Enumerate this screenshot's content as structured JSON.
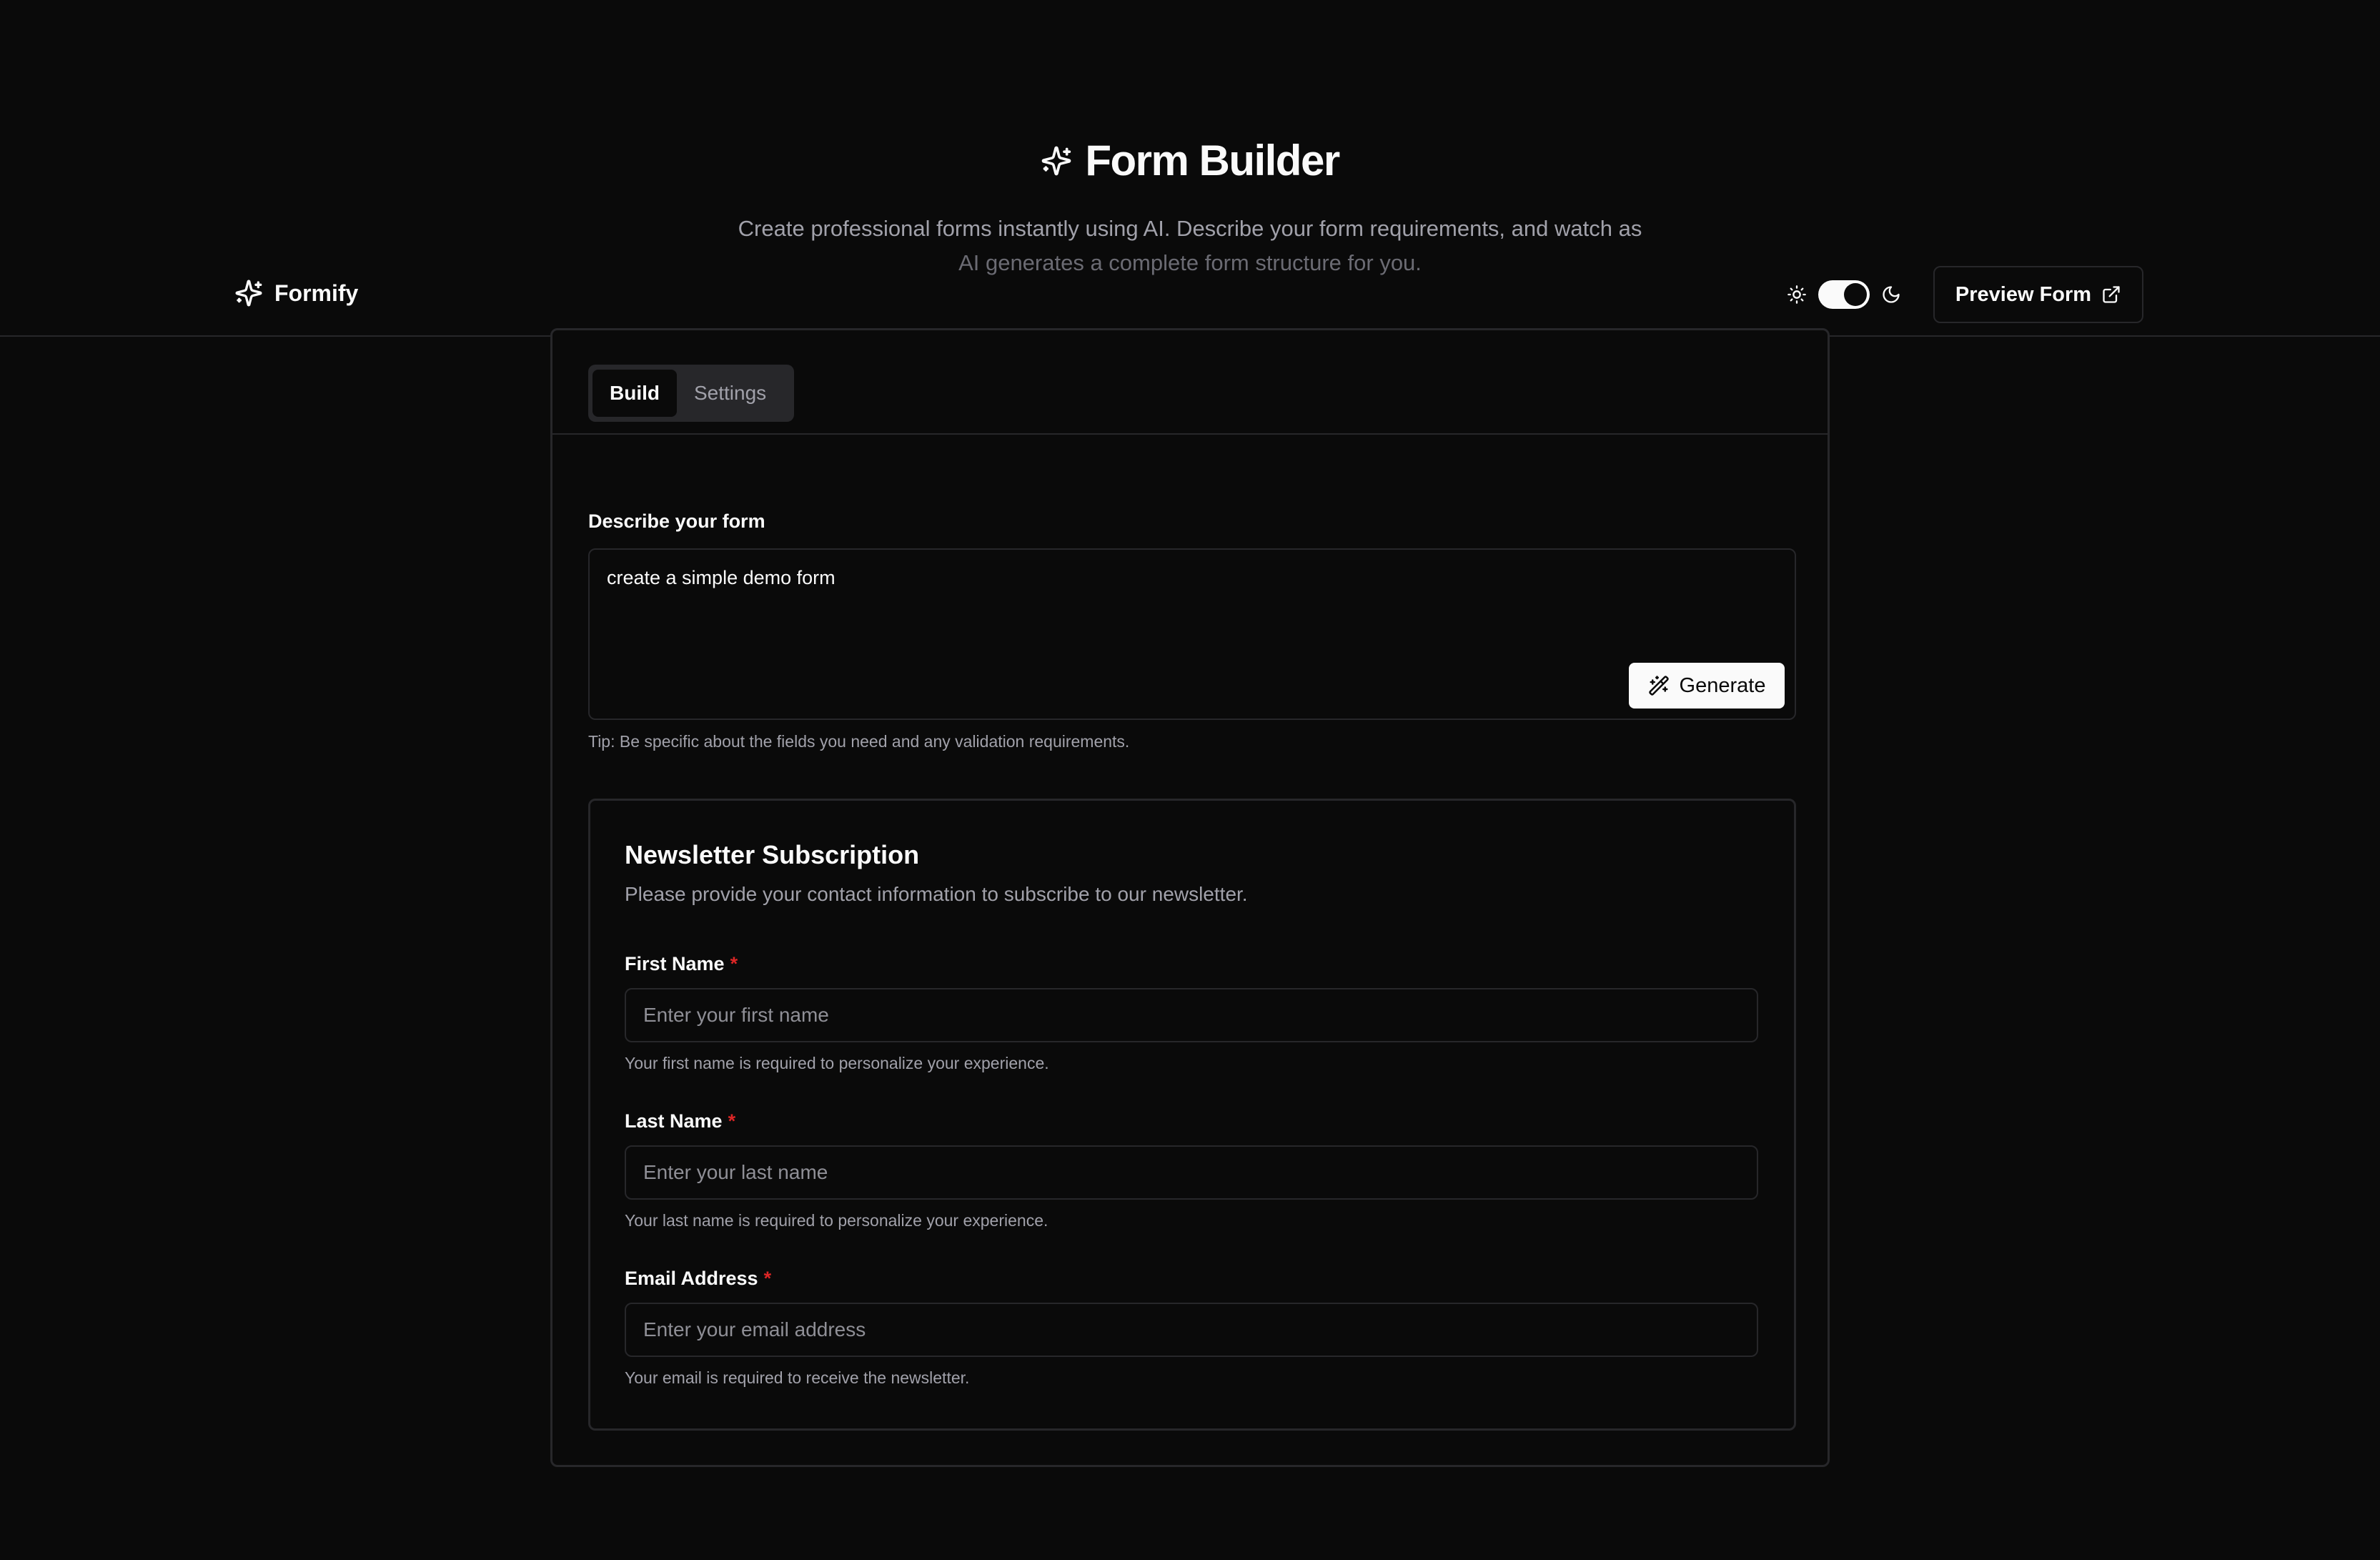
{
  "hero": {
    "title": "Form Builder",
    "description_line1": "Create professional forms instantly using AI. Describe your form requirements, and watch as",
    "description_line2": "AI generates a complete form structure for you."
  },
  "navbar": {
    "brand": "Formify",
    "preview_button": "Preview Form",
    "theme_toggle_on": true
  },
  "builder": {
    "tabs": [
      {
        "label": "Build",
        "active": true
      },
      {
        "label": "Settings",
        "active": false
      }
    ],
    "describe_label": "Describe your form",
    "prompt_value": "create a simple demo form",
    "generate_button": "Generate",
    "tip": "Tip: Be specific about the fields you need and any validation requirements."
  },
  "form": {
    "title": "Newsletter Subscription",
    "subtitle": "Please provide your contact information to subscribe to our newsletter.",
    "required_marker": "*",
    "fields": [
      {
        "label": "First Name",
        "placeholder": "Enter your first name",
        "help": "Your first name is required to personalize your experience."
      },
      {
        "label": "Last Name",
        "placeholder": "Enter your last name",
        "help": "Your last name is required to personalize your experience."
      },
      {
        "label": "Email Address",
        "placeholder": "Enter your email address",
        "help": "Your email is required to receive the newsletter."
      }
    ]
  },
  "colors": {
    "background": "#0a0a0a",
    "border": "#27272a",
    "text": "#fafafa",
    "muted": "#a1a1aa",
    "required": "#dc2626"
  }
}
